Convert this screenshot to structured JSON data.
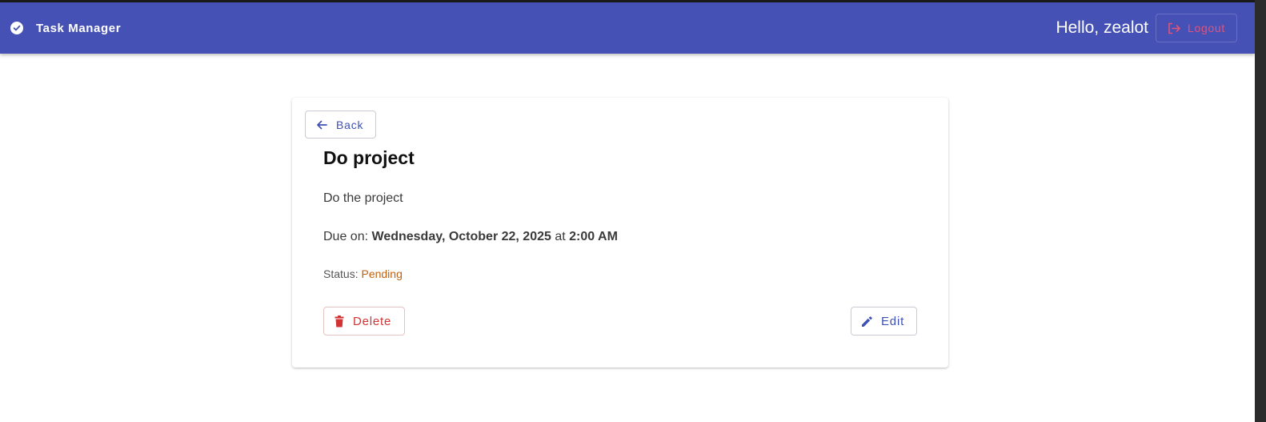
{
  "appbar": {
    "title": "Task Manager",
    "greeting": "Hello, zealot",
    "logout_label": "Logout",
    "color": "#4551b5"
  },
  "task": {
    "back_label": "Back",
    "title": "Do project",
    "description": "Do the project",
    "due_prefix": "Due on:",
    "due_date": "Wednesday, October 22, 2025",
    "due_at": "at",
    "due_time": "2:00 AM",
    "status_label": "Status:",
    "status_value": "Pending",
    "delete_label": "Delete",
    "edit_label": "Edit"
  },
  "icons": {
    "brand": "check-circle-icon",
    "logout": "logout-icon",
    "back": "arrow-left-icon",
    "delete": "trash-icon",
    "edit": "pencil-icon"
  },
  "colors": {
    "primary": "#3f51b5",
    "danger": "#d23434",
    "pending": "#c0620f",
    "logout": "#e0547a"
  }
}
